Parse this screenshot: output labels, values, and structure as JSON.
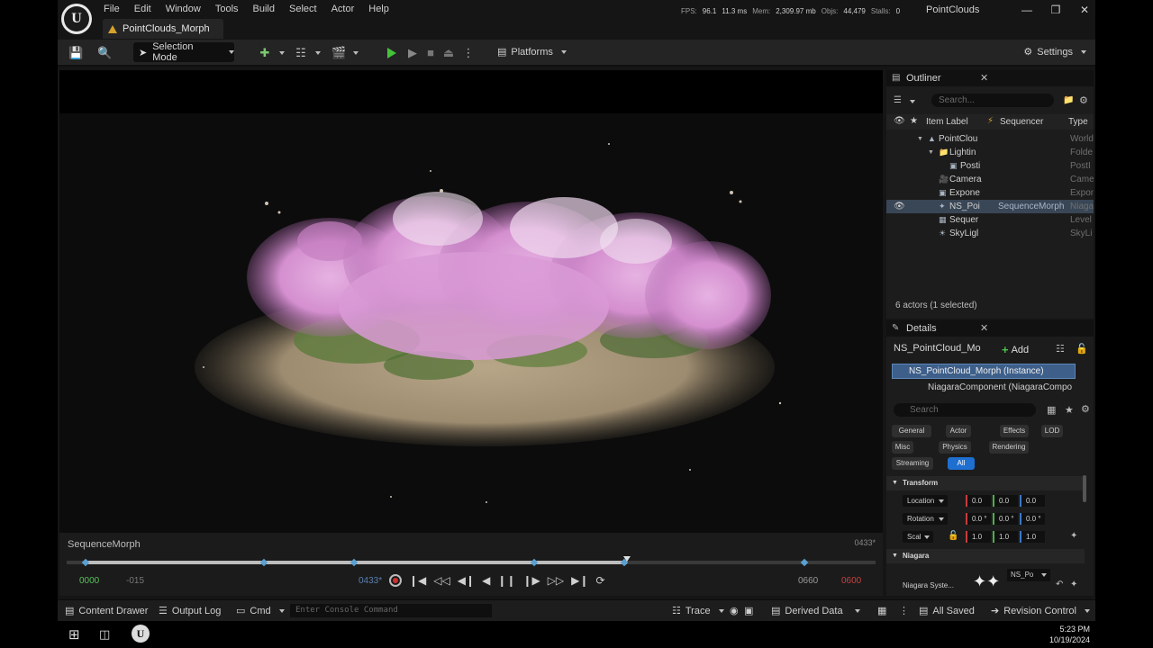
{
  "menu": [
    "File",
    "Edit",
    "Window",
    "Tools",
    "Build",
    "Select",
    "Actor",
    "Help"
  ],
  "document_tab": "PointClouds_Morph",
  "project_name": "PointClouds",
  "stats": {
    "fps_label": "FPS:",
    "fps": "96.1",
    "ms": "11.3 ms",
    "mem_label": "Mem:",
    "mem": "2,309.97 mb",
    "objs_label": "Objs:",
    "objs": "44,479",
    "stalls_label": "Stalls:",
    "stalls": "0"
  },
  "toolbar": {
    "selection_mode": "Selection Mode",
    "platforms": "Platforms",
    "settings": "Settings"
  },
  "sequencer": {
    "name": "SequenceMorph",
    "current_frame_display": "0433*",
    "playback_progress": 0.693,
    "start_tc": "0000",
    "pre_tc": "-015",
    "current_tc": "0433*",
    "end_tc": "0660",
    "post_tc": "0600"
  },
  "outliner": {
    "title": "Outliner",
    "search_placeholder": "Search...",
    "columns": {
      "label": "Item Label",
      "sequencer": "Sequencer",
      "type": "Type"
    },
    "rows": [
      {
        "label": "PointClou",
        "sequencer": "",
        "type": "World",
        "depth": 0
      },
      {
        "label": "Lightin",
        "sequencer": "",
        "type": "Folde",
        "depth": 1
      },
      {
        "label": "Posti",
        "sequencer": "",
        "type": "PostI",
        "depth": 2
      },
      {
        "label": "Camera",
        "sequencer": "",
        "type": "Came",
        "depth": 1
      },
      {
        "label": "Expone",
        "sequencer": "",
        "type": "Expon",
        "depth": 1
      },
      {
        "label": "NS_Poi",
        "sequencer": "SequenceMorph",
        "type": "Niaga",
        "depth": 1,
        "selected": true
      },
      {
        "label": "Sequer",
        "sequencer": "",
        "type": "Level",
        "depth": 1
      },
      {
        "label": "SkyLigl",
        "sequencer": "",
        "type": "SkyLi",
        "depth": 1
      }
    ],
    "count": "6 actors (1 selected)"
  },
  "details": {
    "title": "Details",
    "actor_name": "NS_PointCloud_Mo",
    "add_label": "Add",
    "component_selected": "NS_PointCloud_Morph (Instance)",
    "component_child": "NiagaraComponent (NiagaraCompo",
    "search_placeholder": "Search",
    "filters": [
      "General",
      "Actor",
      "Effects",
      "LOD",
      "Misc",
      "Physics",
      "Rendering",
      "Streaming",
      "All"
    ],
    "active_filter": "All",
    "transform_header": "Transform",
    "location_label": "Location",
    "rotation_label": "Rotation",
    "scale_label": "Scal",
    "location": [
      "0.0",
      "0.0",
      "0.0"
    ],
    "rotation": [
      "0.0 °",
      "0.0 °",
      "0.0 °"
    ],
    "scale": [
      "1.0",
      "1.0",
      "1.0"
    ],
    "niagara_header": "Niagara",
    "niagara_system_label": "Niagara Syste...",
    "niagara_asset": "NS_Po"
  },
  "status_bar": {
    "content_drawer": "Content Drawer",
    "output_log": "Output Log",
    "cmd": "Cmd",
    "console_placeholder": "Enter Console Command",
    "trace": "Trace",
    "derived_data": "Derived Data",
    "all_saved": "All Saved",
    "revision_control": "Revision Control"
  },
  "taskbar": {
    "time": "5:23 PM",
    "date": "10/19/2024"
  },
  "colors": {
    "accent": "#1e6fd0",
    "play": "#44c23a",
    "selection": "#394656",
    "blossom": "#d99ad6"
  }
}
